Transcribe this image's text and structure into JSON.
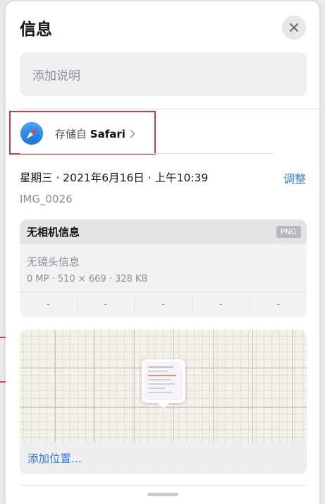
{
  "header": {
    "title": "信息"
  },
  "caption": {
    "placeholder": "添加说明"
  },
  "source": {
    "prefix": "存储自",
    "app": "Safari"
  },
  "meta": {
    "date": "星期三 · 2021年6月16日 · 上午10:39",
    "adjust_label": "调整",
    "filename": "IMG_0026"
  },
  "exif": {
    "title": "无相机信息",
    "format_badge": "PNG",
    "lens": "无镜头信息",
    "specs": "0 MP · 510 × 669 · 328 KB",
    "cells": [
      "-",
      "-",
      "-",
      "-",
      "-"
    ]
  },
  "map": {
    "add_location_label": "添加位置..."
  },
  "colors": {
    "accent": "#2f7de1",
    "highlight_border": "#d9363e"
  },
  "icons": {
    "close": "close-icon",
    "safari": "safari-compass-icon",
    "chevron": "chevron-right-icon"
  }
}
